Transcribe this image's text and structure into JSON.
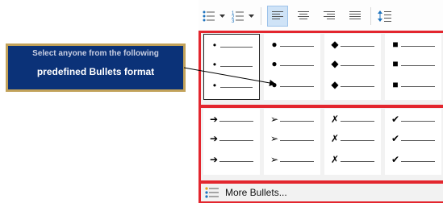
{
  "toolbar": {
    "buttons": [
      {
        "name": "bullets-button",
        "icon": "bullet-list-icon"
      },
      {
        "name": "bullets-dropdown",
        "icon": "chevron-down-icon"
      },
      {
        "name": "numbering-button",
        "icon": "numbered-list-icon"
      },
      {
        "name": "numbering-dropdown",
        "icon": "chevron-down-icon"
      },
      {
        "name": "align-left-button",
        "icon": "align-left-icon",
        "active": true
      },
      {
        "name": "align-center-button",
        "icon": "align-center-icon"
      },
      {
        "name": "align-right-button",
        "icon": "align-right-icon"
      },
      {
        "name": "justify-button",
        "icon": "justify-icon"
      },
      {
        "name": "line-spacing-button",
        "icon": "line-spacing-icon"
      }
    ]
  },
  "gallery": {
    "rows": [
      [
        {
          "symbol": "•",
          "name": "small-dot",
          "selected": true
        },
        {
          "symbol": "●",
          "name": "large-dot"
        },
        {
          "symbol": "◆",
          "name": "diamond"
        },
        {
          "symbol": "■",
          "name": "square"
        }
      ],
      [
        {
          "symbol": "➔",
          "name": "arrow"
        },
        {
          "symbol": "➢",
          "name": "arrowhead"
        },
        {
          "symbol": "✗",
          "name": "cross"
        },
        {
          "symbol": "✔",
          "name": "check"
        }
      ]
    ],
    "more_bullets_label": "More Bullets..."
  },
  "callout": {
    "line1": "Select anyone from the following",
    "line2": "predefined Bullets format"
  },
  "colors": {
    "highlight_border": "#e3262e",
    "callout_bg": "#0b3278",
    "callout_border": "#c2a25a",
    "active_button_bg": "#cfe3f7"
  }
}
